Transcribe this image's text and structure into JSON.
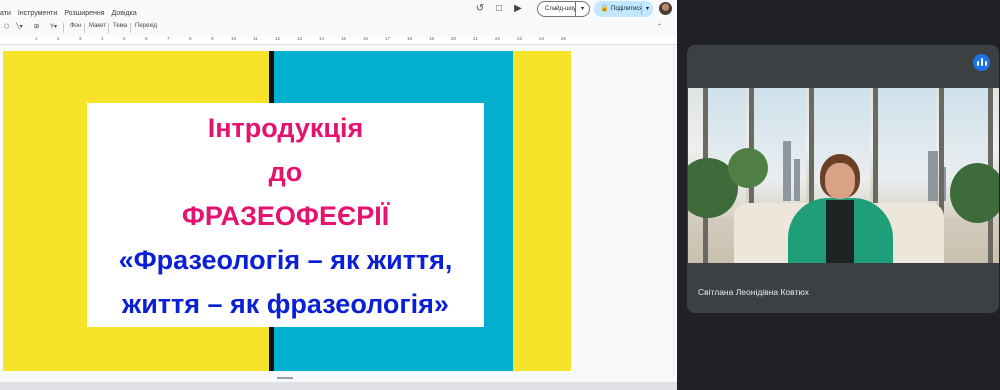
{
  "menu": {
    "items": [
      "ати",
      "Інструменти",
      "Розширення",
      "Довідка"
    ]
  },
  "header": {
    "slideshow_label": "Слайд-шоу",
    "share_label": "Поділитися"
  },
  "toolbar": {
    "background_label": "Фон",
    "layout_label": "Макет",
    "theme_label": "Тема",
    "transition_label": "Перехід"
  },
  "ruler": {
    "labels": [
      "1",
      "2",
      "3",
      "4",
      "5",
      "6",
      "7",
      "8",
      "9",
      "10",
      "11",
      "12",
      "13",
      "14",
      "15",
      "16",
      "17",
      "18",
      "19",
      "20",
      "21",
      "22",
      "23",
      "24",
      "25"
    ]
  },
  "slide": {
    "line1": "Інтродукція",
    "line2": "до",
    "line3": "ФРАЗЕОФЕЄРІЇ",
    "line4": "«Фразеологія – як життя,",
    "line5": "життя – як фразеологія»",
    "colors": {
      "background": "#f6e42a",
      "stripe": "#111111",
      "panel": "#00b0ce",
      "pink_text": "#e5136f",
      "blue_text": "#0a1fd6"
    }
  },
  "call": {
    "participant_name": "Світлана Леонідівна Ковтюх"
  }
}
